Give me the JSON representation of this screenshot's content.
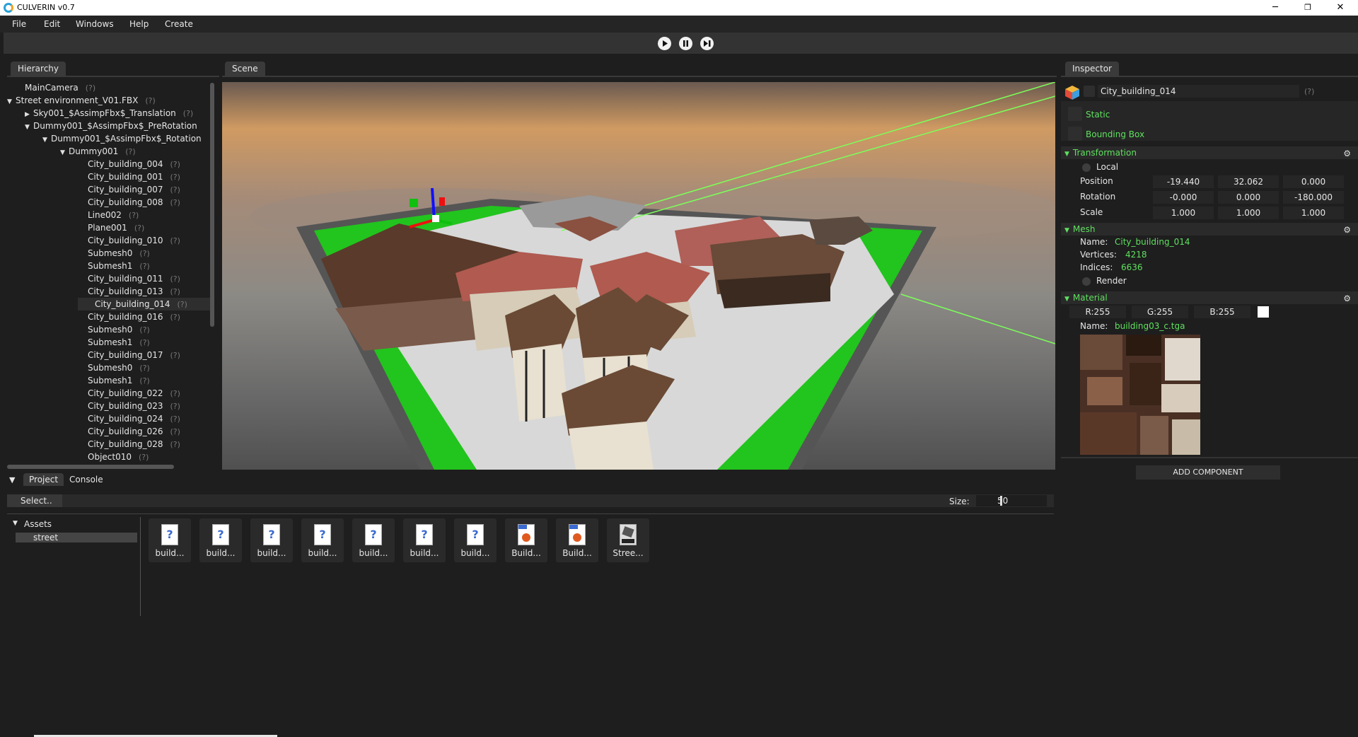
{
  "window": {
    "title": "CULVERIN v0.7",
    "minimize": "─",
    "maximize": "❐",
    "close": "✕"
  },
  "menu": [
    "File",
    "Edit",
    "Windows",
    "Help",
    "Create"
  ],
  "tabs": {
    "hierarchy": "Hierarchy",
    "scene": "Scene",
    "inspector": "Inspector",
    "project": "Project",
    "console": "Console"
  },
  "hierarchy": [
    {
      "label": "MainCamera",
      "q": "(?)",
      "arrow": ""
    },
    {
      "label": "Street environment_V01.FBX",
      "q": "(?)",
      "arrow": "▼"
    },
    {
      "label": "Sky001_$AssimpFbx$_Translation",
      "q": "(?)",
      "arrow": "▶"
    },
    {
      "label": "Dummy001_$AssimpFbx$_PreRotation",
      "q": "",
      "arrow": "▼"
    },
    {
      "label": "Dummy001_$AssimpFbx$_Rotation",
      "q": "",
      "arrow": "▼"
    },
    {
      "label": "Dummy001",
      "q": "(?)",
      "arrow": "▼"
    },
    {
      "label": "City_building_004",
      "q": "(?)",
      "arrow": ""
    },
    {
      "label": "City_building_001",
      "q": "(?)",
      "arrow": ""
    },
    {
      "label": "City_building_007",
      "q": "(?)",
      "arrow": ""
    },
    {
      "label": "City_building_008",
      "q": "(?)",
      "arrow": ""
    },
    {
      "label": "Line002",
      "q": "(?)",
      "arrow": ""
    },
    {
      "label": "Plane001",
      "q": "(?)",
      "arrow": ""
    },
    {
      "label": "City_building_010",
      "q": "(?)",
      "arrow": ""
    },
    {
      "label": "Submesh0",
      "q": "(?)",
      "arrow": ""
    },
    {
      "label": "Submesh1",
      "q": "(?)",
      "arrow": ""
    },
    {
      "label": "City_building_011",
      "q": "(?)",
      "arrow": ""
    },
    {
      "label": "City_building_013",
      "q": "(?)",
      "arrow": ""
    },
    {
      "label": "City_building_014",
      "q": "(?)",
      "arrow": ""
    },
    {
      "label": "City_building_016",
      "q": "(?)",
      "arrow": ""
    },
    {
      "label": "Submesh0",
      "q": "(?)",
      "arrow": ""
    },
    {
      "label": "Submesh1",
      "q": "(?)",
      "arrow": ""
    },
    {
      "label": "City_building_017",
      "q": "(?)",
      "arrow": ""
    },
    {
      "label": "Submesh0",
      "q": "(?)",
      "arrow": ""
    },
    {
      "label": "Submesh1",
      "q": "(?)",
      "arrow": ""
    },
    {
      "label": "City_building_022",
      "q": "(?)",
      "arrow": ""
    },
    {
      "label": "City_building_023",
      "q": "(?)",
      "arrow": ""
    },
    {
      "label": "City_building_024",
      "q": "(?)",
      "arrow": ""
    },
    {
      "label": "City_building_026",
      "q": "(?)",
      "arrow": ""
    },
    {
      "label": "City_building_028",
      "q": "(?)",
      "arrow": ""
    },
    {
      "label": "Object010",
      "q": "(?)",
      "arrow": ""
    }
  ],
  "inspector": {
    "object_name": "City_building_014",
    "help": "(?)",
    "static_label": "Static",
    "bounding_box_label": "Bounding Box",
    "transformation": {
      "header": "Transformation",
      "local_label": "Local",
      "position_label": "Position",
      "rotation_label": "Rotation",
      "scale_label": "Scale",
      "position": [
        "-19.440",
        "32.062",
        "0.000"
      ],
      "rotation": [
        "-0.000",
        "0.000",
        "-180.000"
      ],
      "scale": [
        "1.000",
        "1.000",
        "1.000"
      ]
    },
    "mesh": {
      "header": "Mesh",
      "name_label": "Name:",
      "name": "City_building_014",
      "vertices_label": "Vertices:",
      "vertices": "4218",
      "indices_label": "Indices:",
      "indices": "6636",
      "render_label": "Render"
    },
    "material": {
      "header": "Material",
      "r": "R:255",
      "g": "G:255",
      "b": "B:255",
      "name_label": "Name:",
      "name": "building03_c.tga"
    },
    "add_component": "ADD COMPONENT"
  },
  "project": {
    "select_label": "Select..",
    "size_label": "Size:",
    "size_value": "50",
    "tree_root": "Assets",
    "tree_child": "street",
    "assets": [
      {
        "caption": "build...",
        "type": "unknown"
      },
      {
        "caption": "build...",
        "type": "unknown"
      },
      {
        "caption": "build...",
        "type": "unknown"
      },
      {
        "caption": "build...",
        "type": "unknown"
      },
      {
        "caption": "build...",
        "type": "unknown"
      },
      {
        "caption": "build...",
        "type": "unknown"
      },
      {
        "caption": "build...",
        "type": "unknown"
      },
      {
        "caption": "Build...",
        "type": "png"
      },
      {
        "caption": "Build...",
        "type": "png"
      },
      {
        "caption": "Stree...",
        "type": "fbx"
      }
    ]
  },
  "colors": {
    "accent_green": "#5fe05f",
    "panel": "#1e1e1e",
    "toolbar": "#333333",
    "ground_green": "#22c41e"
  },
  "icons": [
    "play-icon",
    "pause-icon",
    "step-icon",
    "gear-icon",
    "cube-icon",
    "question-file-icon",
    "png-file-icon",
    "fbx-file-icon"
  ]
}
